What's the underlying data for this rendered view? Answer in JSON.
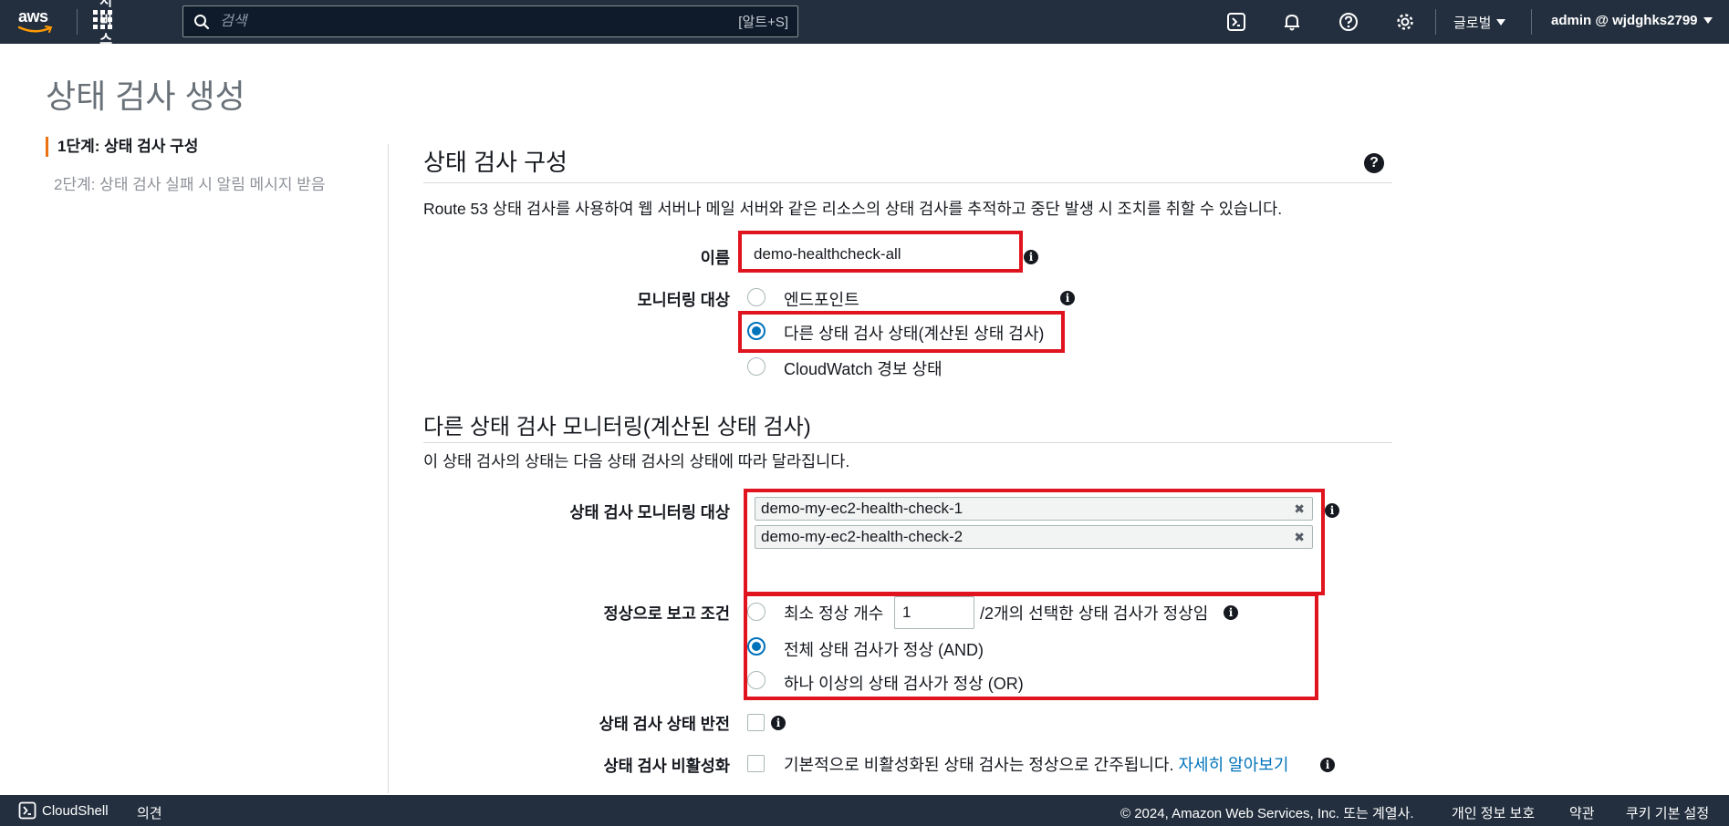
{
  "nav": {
    "logo_text": "aws",
    "services_label": "서비스",
    "search_placeholder": "검색",
    "search_shortcut": "[알트+S]",
    "region_label": "글로벌",
    "account_label": "admin @ wjdghks2799"
  },
  "page": {
    "title": "상태 검사 생성"
  },
  "steps": [
    {
      "label": "1단계: 상태 검사 구성",
      "active": true
    },
    {
      "label": "2단계: 상태 검사 실패 시 알림 메시지 받음",
      "active": false
    }
  ],
  "config": {
    "title": "상태 검사 구성",
    "description": "Route 53 상태 검사를 사용하여 웹 서버나 메일 서버와 같은 리소스의 상태 검사를 추적하고 중단 발생 시 조치를 취할 수 있습니다.",
    "name_label": "이름",
    "name_value": "demo-healthcheck-all",
    "monitor_label": "모니터링 대상",
    "monitor_options": [
      {
        "label": "엔드포인트",
        "checked": false
      },
      {
        "label": "다른 상태 검사 상태(계산된 상태 검사)",
        "checked": true
      },
      {
        "label": "CloudWatch 경보 상태",
        "checked": false
      }
    ]
  },
  "calculated": {
    "title": "다른 상태 검사 모니터링(계산된 상태 검사)",
    "description": "이 상태 검사의 상태는 다음 상태 검사의 상태에 따라 달라집니다.",
    "monitored_label": "상태 검사 모니터링 대상",
    "monitored_items": [
      "demo-my-ec2-health-check-1",
      "demo-my-ec2-health-check-2"
    ],
    "healthy_label": "정상으로 보고 조건",
    "healthy_min_prefix": "최소 정상 개수",
    "healthy_min_value": "1",
    "healthy_min_suffix": "/2개의 선택한 상태 검사가 정상임",
    "healthy_and": "전체 상태 검사가 정상 (AND)",
    "healthy_or": "하나 이상의 상태 검사가 정상 (OR)",
    "healthy_selected": "and",
    "invert_label": "상태 검사 상태 반전",
    "disable_label": "상태 검사 비활성화",
    "disable_text": "기본적으로 비활성화된 상태 검사는 정상으로 간주됩니다.",
    "disable_link": "자세히 알아보기"
  },
  "footer": {
    "cloudshell": "CloudShell",
    "feedback": "의견",
    "copyright": "© 2024, Amazon Web Services, Inc. 또는 계열사.",
    "privacy": "개인 정보 보호",
    "terms": "약관",
    "cookies": "쿠키 기본 설정"
  },
  "colors": {
    "nav_bg": "#232f3e",
    "accent": "#ec7211",
    "link": "#0073bb",
    "highlight": "#e0141e"
  }
}
